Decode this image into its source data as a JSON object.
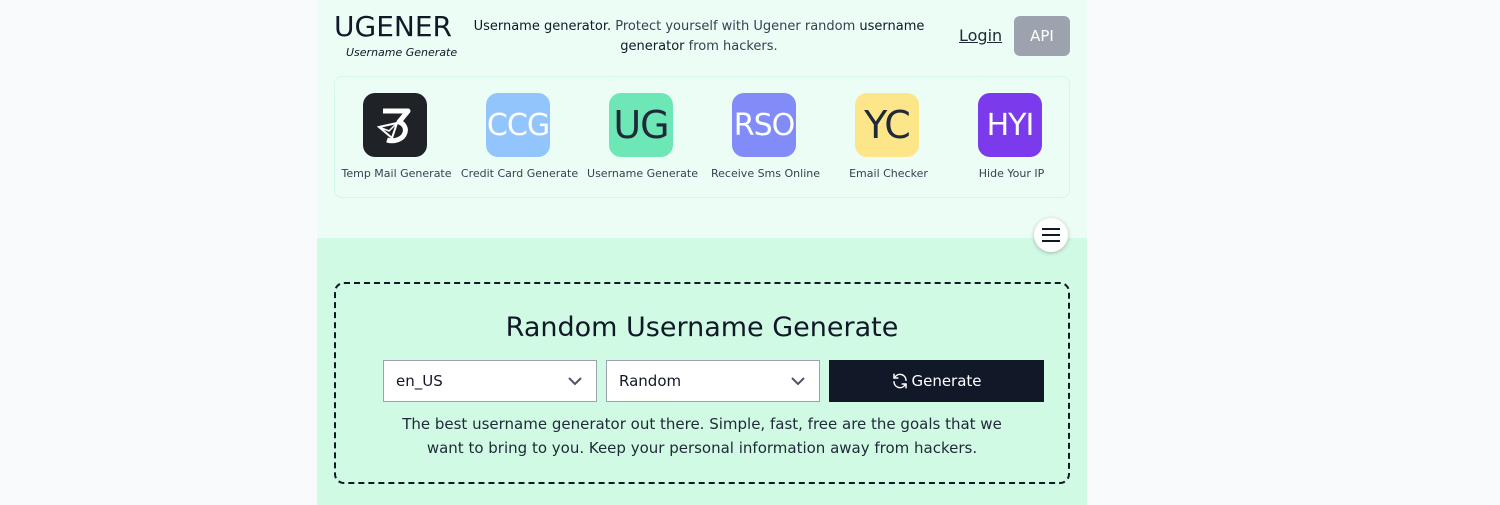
{
  "header": {
    "logo": "UGENER",
    "logo_sub": "Username Generate",
    "tagline_bold1": "Username generator.",
    "tagline_text1": " Protect yourself with Ugener random ",
    "tagline_bold2": "username generator",
    "tagline_text2": " from hackers.",
    "login_label": "Login",
    "api_label": "API"
  },
  "tools": [
    {
      "abbr": "",
      "label": "Temp Mail Generate",
      "bg": "#1f2328",
      "fg": "#ffffff",
      "icon": "temp-mail-logo-icon"
    },
    {
      "abbr": "CCG",
      "label": "Credit Card Generate",
      "bg": "#93c5fd",
      "fg": "#ffffff"
    },
    {
      "abbr": "UG",
      "label": "Username Generate",
      "bg": "#6ee7b7",
      "fg": "#1f2937"
    },
    {
      "abbr": "RSO",
      "label": "Receive Sms Online",
      "bg": "#818cf8",
      "fg": "#ffffff"
    },
    {
      "abbr": "YC",
      "label": "Email Checker",
      "bg": "#fde68a",
      "fg": "#1f2937"
    },
    {
      "abbr": "HYI",
      "label": "Hide Your IP",
      "bg": "#7c3aed",
      "fg": "#ffffff"
    }
  ],
  "generator": {
    "title": "Random Username Generate",
    "locale_value": "en_US",
    "type_value": "Random",
    "generate_label": "Generate",
    "description": "The best username generator out there. Simple, fast, free are the goals that we want to bring to you. Keep your personal information away from hackers."
  },
  "colors": {
    "page_bg": "#ecfdf5",
    "main_bg": "#d1fae5",
    "button_dark": "#111827",
    "api_gray": "#9ca3af"
  }
}
